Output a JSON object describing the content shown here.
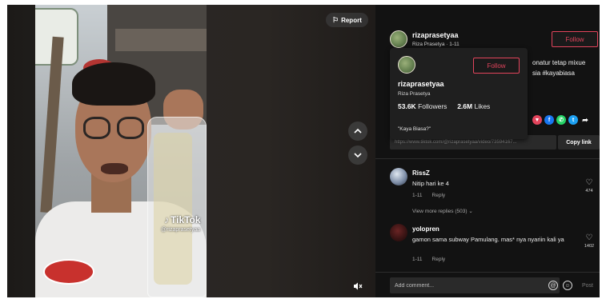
{
  "video": {
    "report_label": "Report",
    "watermark_brand": "TikTok",
    "watermark_handle": "@rizaprasetyaa",
    "icons": {
      "report": "flag-icon",
      "prev": "chevron-up-icon",
      "next": "chevron-down-icon",
      "mute": "speaker-mute-icon",
      "watermark": "tiktok-logo-icon"
    }
  },
  "author": {
    "username": "rizaprasetyaa",
    "subtitle": "Riza Prasetya · 1-11",
    "follow_label": "Follow"
  },
  "caption": {
    "line1": "onatur tetap mixue",
    "line2": "sia #kayabiasa"
  },
  "popup": {
    "username": "rizaprasetyaa",
    "display_name": "Riza Prasetya",
    "followers_value": "53.6K",
    "followers_label": "Followers",
    "likes_value": "2.6M",
    "likes_label": "Likes",
    "bio": "\"Kaya Biasa?\"",
    "follow_label": "Follow"
  },
  "share": {
    "icons": [
      {
        "name": "share-red-icon",
        "glyph": "▼",
        "color": "#e2445c"
      },
      {
        "name": "facebook-icon",
        "glyph": "f",
        "color": "#1877f2"
      },
      {
        "name": "whatsapp-icon",
        "glyph": "✆",
        "color": "#25d366"
      },
      {
        "name": "twitter-icon",
        "glyph": "t",
        "color": "#1da1f2"
      },
      {
        "name": "share-arrow-icon",
        "glyph": "➦",
        "color": "transparent"
      }
    ],
    "link_text": "https://www.tiktok.com/@rizaprasetyaa/video/73594167...",
    "copy_label": "Copy link"
  },
  "comments": [
    {
      "user": "RissZ",
      "text": "Nitip hari ke 4",
      "date": "1-11",
      "reply_label": "Reply",
      "likes": "474"
    },
    {
      "user": "yolopren",
      "text": "gamon sama subway Pamulang. mas* nya nyariin kali ya",
      "date": "1-11",
      "reply_label": "Reply",
      "likes": "1402"
    }
  ],
  "view_more_replies": "View more replies (503) ⌄",
  "comment_box": {
    "placeholder": "Add comment...",
    "post_label": "Post"
  },
  "colors": {
    "accent": "#e2445c",
    "panel_bg": "#121212"
  }
}
